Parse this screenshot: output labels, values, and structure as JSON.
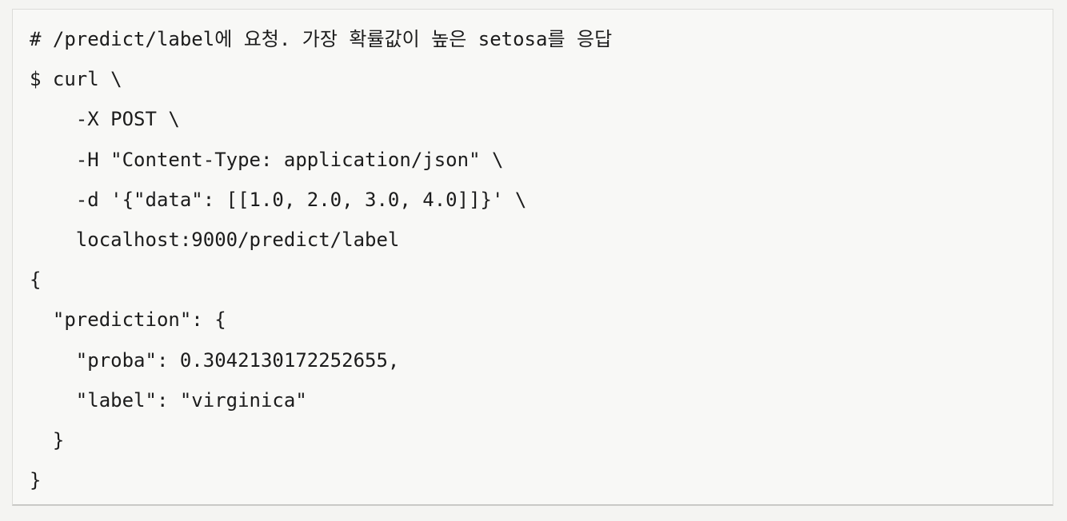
{
  "code_block": {
    "lines": [
      "# /predict/label에 요청. 가장 확률값이 높은 setosa를 응답",
      "$ curl \\",
      "    -X POST \\",
      "    -H \"Content-Type: application/json\" \\",
      "    -d '{\"data\": [[1.0, 2.0, 3.0, 4.0]]}' \\",
      "    localhost:9000/predict/label",
      "{",
      "  \"prediction\": {",
      "    \"proba\": 0.3042130172252655,",
      "    \"label\": \"virginica\"",
      "  }",
      "}"
    ]
  }
}
